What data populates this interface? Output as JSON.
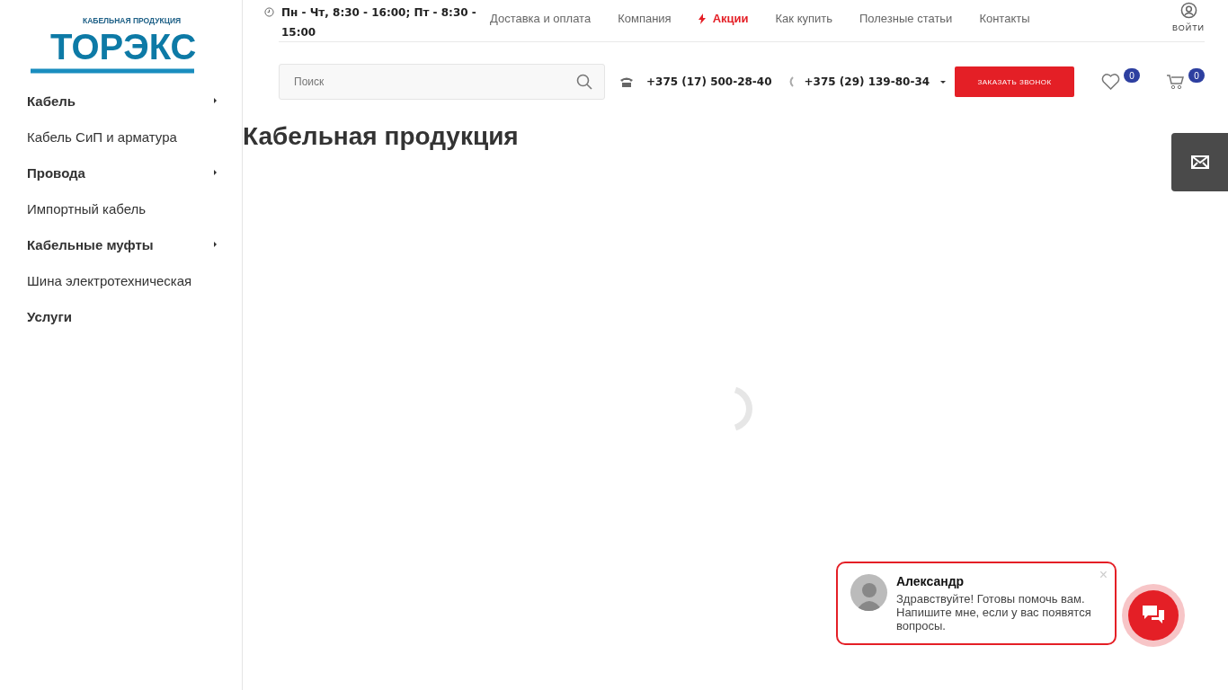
{
  "logo": {
    "tagline": "КАБЕЛЬНАЯ ПРОДУКЦИЯ",
    "name": "ТОРЭКС"
  },
  "sidebar": {
    "items": [
      {
        "label": "Кабель",
        "kind": "section",
        "has_submenu": true
      },
      {
        "label": "Кабель СиП и арматура",
        "kind": "link",
        "has_submenu": false
      },
      {
        "label": "Провода",
        "kind": "section",
        "has_submenu": true
      },
      {
        "label": "Импортный кабель",
        "kind": "link",
        "has_submenu": false
      },
      {
        "label": "Кабельные муфты",
        "kind": "section",
        "has_submenu": true
      },
      {
        "label": "Шина электротехническая",
        "kind": "link",
        "has_submenu": false
      },
      {
        "label": "Услуги",
        "kind": "section",
        "has_submenu": false
      }
    ]
  },
  "header": {
    "schedule": "Пн - Чт, 8:30 - 16:00; Пт - 8:30 - 15:00",
    "nav": [
      {
        "label": "Доставка и оплата",
        "kind": "link"
      },
      {
        "label": "Компания",
        "kind": "link"
      },
      {
        "label": "Акции",
        "kind": "promo"
      },
      {
        "label": "Как купить",
        "kind": "link"
      },
      {
        "label": "Полезные статьи",
        "kind": "link"
      },
      {
        "label": "Контакты",
        "kind": "link"
      }
    ],
    "login": "ВОЙТИ",
    "search": {
      "placeholder": "Поиск"
    },
    "phones": [
      "+375 (17) 500-28-40",
      "+375 (29) 139-80-34"
    ],
    "callback_button": "ЗАКАЗАТЬ ЗВОНОК",
    "favorites_count": "0",
    "cart_count": "0"
  },
  "page": {
    "title": "Кабельная продукция"
  },
  "chat": {
    "name": "Александр",
    "message": "Здравствуйте! Готовы помочь вам. Напишите мне, если у вас появятся вопросы.",
    "close": "×"
  }
}
